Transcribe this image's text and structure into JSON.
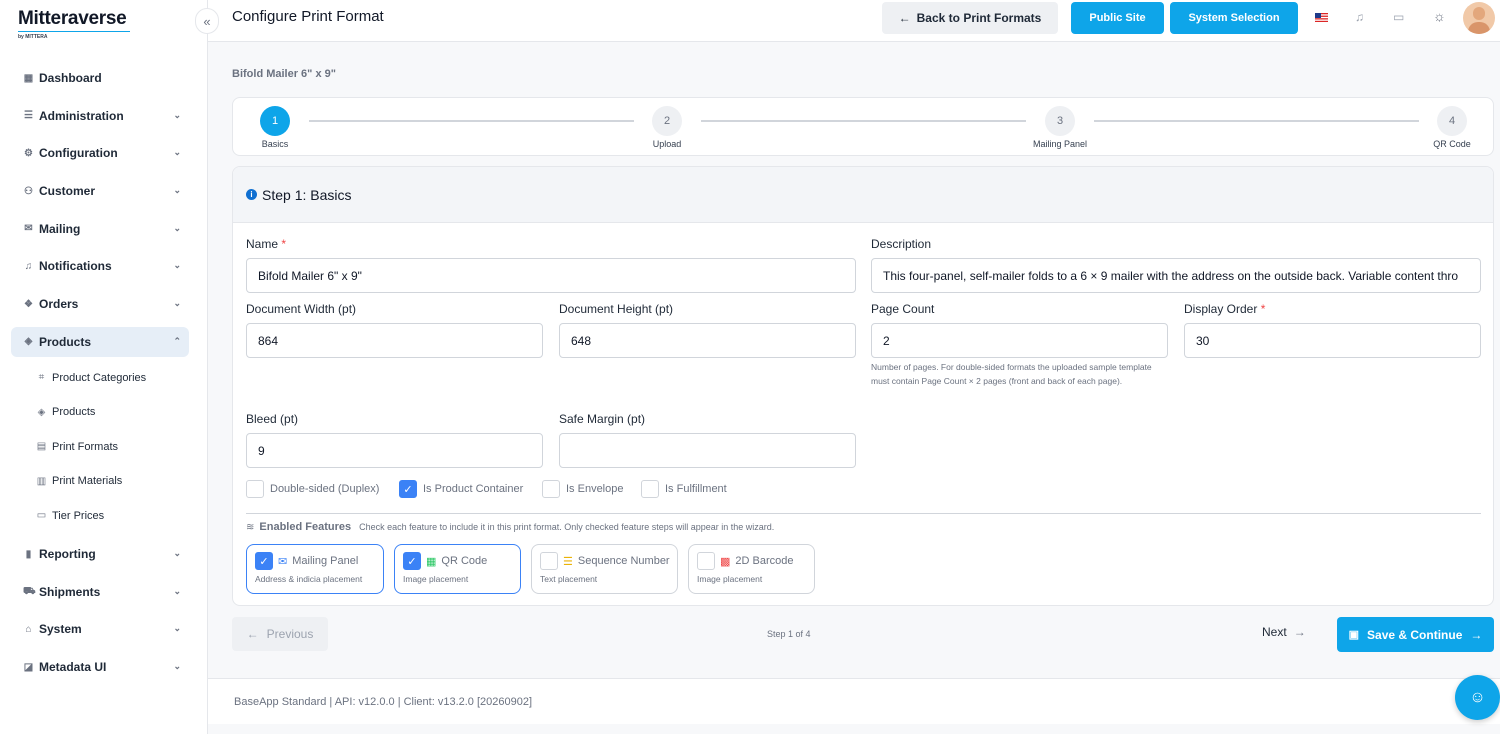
{
  "brand": {
    "name": "Mitteraverse",
    "sub": "by MITTERA"
  },
  "nav": {
    "items": [
      {
        "label": "Dashboard",
        "icon": "dashboard-icon",
        "chevron": false
      },
      {
        "label": "Administration",
        "icon": "admin-icon",
        "chevron": true
      },
      {
        "label": "Configuration",
        "icon": "gear-icon",
        "chevron": true
      },
      {
        "label": "Customer",
        "icon": "customer-icon",
        "chevron": true
      },
      {
        "label": "Mailing",
        "icon": "mail-icon",
        "chevron": true
      },
      {
        "label": "Notifications",
        "icon": "bell-icon",
        "chevron": true
      },
      {
        "label": "Orders",
        "icon": "orders-icon",
        "chevron": true
      },
      {
        "label": "Products",
        "icon": "products-icon",
        "chevron": true,
        "active": true
      }
    ],
    "sub_items": [
      {
        "label": "Product Categories",
        "icon": "tag-icon"
      },
      {
        "label": "Products",
        "icon": "products-icon"
      },
      {
        "label": "Print Formats",
        "icon": "document-icon"
      },
      {
        "label": "Print Materials",
        "icon": "materials-icon"
      },
      {
        "label": "Tier Prices",
        "icon": "price-icon"
      }
    ],
    "items_after": [
      {
        "label": "Reporting",
        "icon": "chart-icon"
      },
      {
        "label": "Shipments",
        "icon": "truck-icon"
      },
      {
        "label": "System",
        "icon": "system-icon"
      },
      {
        "label": "Metadata UI",
        "icon": "metadata-icon"
      }
    ]
  },
  "header": {
    "title": "Configure Print Format",
    "back_label": "Back to Print Formats",
    "public_site_label": "Public Site",
    "system_selection_label": "System Selection"
  },
  "breadcrumb": "Bifold Mailer 6\" x 9\"",
  "steps": [
    {
      "num": "1",
      "label": "Basics",
      "active": true
    },
    {
      "num": "2",
      "label": "Upload"
    },
    {
      "num": "3",
      "label": "Mailing Panel"
    },
    {
      "num": "4",
      "label": "QR Code"
    }
  ],
  "card": {
    "title": "Step 1: Basics",
    "name_label": "Name",
    "name_value": "Bifold Mailer 6\" x 9\"",
    "description_label": "Description",
    "description_value": "This four-panel, self-mailer folds to a 6 × 9 mailer with the address on the outside back. Variable content thro",
    "width_label": "Document Width (pt)",
    "width_value": "864",
    "height_label": "Document Height (pt)",
    "height_value": "648",
    "page_count_label": "Page Count",
    "page_count_value": "2",
    "page_count_help": "Number of pages. For double-sided formats the uploaded sample template must contain Page Count × 2 pages (front and back of each page).",
    "display_order_label": "Display Order",
    "display_order_value": "30",
    "bleed_label": "Bleed (pt)",
    "bleed_value": "9",
    "safe_margin_label": "Safe Margin (pt)",
    "safe_margin_value": "",
    "checkboxes": [
      {
        "label": "Double-sided (Duplex)",
        "checked": false
      },
      {
        "label": "Is Product Container",
        "checked": true
      },
      {
        "label": "Is Envelope",
        "checked": false
      },
      {
        "label": "Is Fulfillment",
        "checked": false
      }
    ],
    "features_title": "Enabled Features",
    "features_desc": "Check each feature to include it in this print format. Only checked feature steps will appear in the wizard.",
    "features": [
      {
        "label": "Mailing Panel",
        "sub": "Address & indicia placement",
        "checked": true,
        "icon": "mail-icon",
        "color": "#3b82f6"
      },
      {
        "label": "QR Code",
        "sub": "Image placement",
        "checked": true,
        "icon": "qr-icon",
        "color": "#22c55e"
      },
      {
        "label": "Sequence Number",
        "sub": "Text placement",
        "checked": false,
        "icon": "list-icon",
        "color": "#eab308"
      },
      {
        "label": "2D Barcode",
        "sub": "Image placement",
        "checked": false,
        "icon": "barcode-icon",
        "color": "#ef4444"
      }
    ]
  },
  "footer_nav": {
    "previous_label": "Previous",
    "step_count": "Step 1 of 4",
    "next_label": "Next",
    "save_label": "Save & Continue"
  },
  "app_footer": "BaseApp Standard | API: v12.0.0 | Client: v13.2.0 [20260902]",
  "colors": {
    "accent": "#0ea5e9",
    "checkbox": "#3b82f6"
  }
}
